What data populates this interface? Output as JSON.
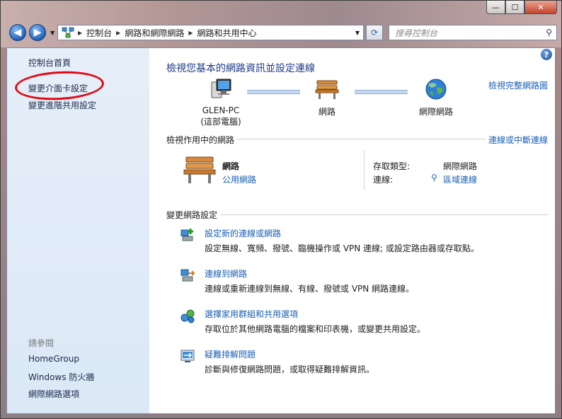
{
  "window": {
    "min_label": "—",
    "max_label": "☐",
    "close_label": "✕"
  },
  "navbar": {
    "back_label": "◀",
    "forward_label": "▶",
    "breadcrumbs": [
      "控制台",
      "網路和網際網路",
      "網路和共用中心"
    ],
    "search_placeholder": "搜尋控制台"
  },
  "sidebar": {
    "items": [
      {
        "label": "控制台首頁"
      },
      {
        "label": "變更介面卡設定"
      },
      {
        "label": "變更進階共用設定"
      }
    ],
    "see_also_label": "請參閱",
    "see_also": [
      {
        "label": "HomeGroup"
      },
      {
        "label": "Windows 防火牆"
      },
      {
        "label": "網際網路選項"
      }
    ]
  },
  "main": {
    "title": "檢視您基本的網路資訊並設定連線",
    "view_full_map": "檢視完整網路圖",
    "map": {
      "computer_name": "GLEN-PC",
      "computer_sub": "(這部電腦)",
      "network_label": "網路",
      "internet_label": "網際網路"
    },
    "active_title": "檢視作用中的網路",
    "connect_disconnect": "連線或中斷連線",
    "active_network": {
      "name": "網路",
      "type": "公用網路",
      "access_type_label": "存取類型:",
      "access_type_value": "網際網路",
      "connections_label": "連線:",
      "connections_value": "區域連線"
    },
    "change_title": "變更網路設定",
    "tasks": [
      {
        "title": "設定新的連線或網路",
        "desc": "設定無線、寬頻、撥號、臨機操作或 VPN 連線; 或設定路由器或存取點。"
      },
      {
        "title": "連線到網路",
        "desc": "連線或重新連線到無線、有線、撥號或 VPN 網路連線。"
      },
      {
        "title": "選擇家用群組和共用選項",
        "desc": "存取位於其他網路電腦的檔案和印表機，或變更共用設定。"
      },
      {
        "title": "疑難排解問題",
        "desc": "診斷與修復網路問題，或取得疑難排解資訊。"
      }
    ]
  },
  "colors": {
    "link": "#1a5fb4",
    "title": "#1e3a8a",
    "annotation": "#e00a14",
    "sidebar_bg": "#dbe8f6"
  }
}
